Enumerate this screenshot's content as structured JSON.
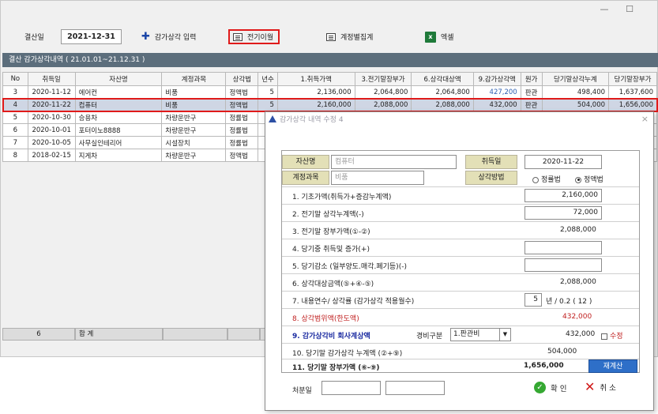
{
  "window": {
    "minimize": "—",
    "maximize": "☐"
  },
  "toolbar": {
    "period_label": "결산일",
    "period_value": "2021-12-31",
    "add_label": "감가상각 입력",
    "transfer_label": "전기이월",
    "account_sum_label": "계정별집계",
    "excel_label": "엑셀"
  },
  "section_title": "결산 감가상각내역 ( 21.01.01~21.12.31 )",
  "table": {
    "headers": [
      "No",
      "취득일",
      "자산명",
      "계정과목",
      "상각법",
      "년수",
      "1.취득가액",
      "3.전기말장부가",
      "6.상각대상액",
      "9.감가상각액",
      "원가",
      "당기말상각누계",
      "당기말장부가"
    ],
    "rows": [
      [
        "3",
        "2020-11-12",
        "에어컨",
        "비품",
        "정액법",
        "5",
        "2,136,000",
        "2,064,800",
        "2,064,800",
        "427,200",
        "판관",
        "498,400",
        "1,637,600"
      ],
      [
        "4",
        "2020-11-22",
        "컴퓨터",
        "비품",
        "정액법",
        "5",
        "2,160,000",
        "2,088,000",
        "2,088,000",
        "432,000",
        "판관",
        "504,000",
        "1,656,000"
      ],
      [
        "5",
        "2020-10-30",
        "승용차",
        "차량운반구",
        "정률법",
        "",
        "",
        "",
        "",
        "",
        "",
        "",
        ""
      ],
      [
        "6",
        "2020-10-01",
        "포터이노8888",
        "차량운반구",
        "정률법",
        "",
        "",
        "",
        "",
        "",
        "",
        "",
        ""
      ],
      [
        "7",
        "2020-10-05",
        "사무실인테리어",
        "시설장치",
        "정률법",
        "",
        "",
        "",
        "",
        "",
        "",
        "",
        ""
      ],
      [
        "8",
        "2018-02-15",
        "지게차",
        "차량운반구",
        "정액법",
        "",
        "",
        "",
        "",
        "",
        "",
        "",
        ""
      ]
    ],
    "summary": {
      "count": "6",
      "label": "합 계"
    }
  },
  "dialog": {
    "title": "감가상각 내역 수정 4",
    "close": "×",
    "asset_name_label": "자산명",
    "asset_name_value": "컴퓨터",
    "acquire_date_label": "취득일",
    "acquire_date_value": "2020-11-22",
    "account_label": "계정과목",
    "account_value": "비품",
    "method_label": "상각방법",
    "method_options": [
      "정률법",
      "정액법"
    ],
    "method_selected": "정액법",
    "lines": [
      {
        "label": "1. 기초가액(취득가+증감누계액)",
        "value": "2,160,000"
      },
      {
        "label": "2. 전기말 상각누계액(-)",
        "value": "72,000"
      },
      {
        "label": "3. 전기말 장부가액(①-②)",
        "value": "2,088,000"
      },
      {
        "label": "4. 당기중 취득및 증가(+)",
        "value": ""
      },
      {
        "label": "5. 당기감소 (일부양도.매각.폐기등)(-)",
        "value": ""
      },
      {
        "label": "6. 상각대상금액(⑤+④-⑤)",
        "value": "2,088,000"
      },
      {
        "label": "7. 내용연수/ 상각률 (감가상각 적용월수)",
        "years": "5",
        "rate_text": "년 / 0.2 ( 12 )"
      },
      {
        "label": "8. 상각범위액(한도액)",
        "value": "432,000"
      },
      {
        "label": "9. 감가상각비 회사계상액",
        "value": "432,000",
        "expense_label": "경비구분",
        "expense_value": "1.판관비",
        "modify_label": "수정"
      },
      {
        "label": "10. 당기말 감가상각 누계액 (②+⑨)",
        "value": "504,000"
      },
      {
        "label": "11. 당기말 장부가액 (⑥-⑨)",
        "value": "1,656,000",
        "recalc_label": "재계산"
      }
    ],
    "disposal_label": "처분일",
    "ok_label": "확 인",
    "cancel_label": "취 소"
  },
  "colors": {
    "accent_red": "#e01a1a",
    "header_bar": "#5c6e7c",
    "label_cell": "#e3e0b7",
    "recalc_blue": "#2e6fc8"
  }
}
